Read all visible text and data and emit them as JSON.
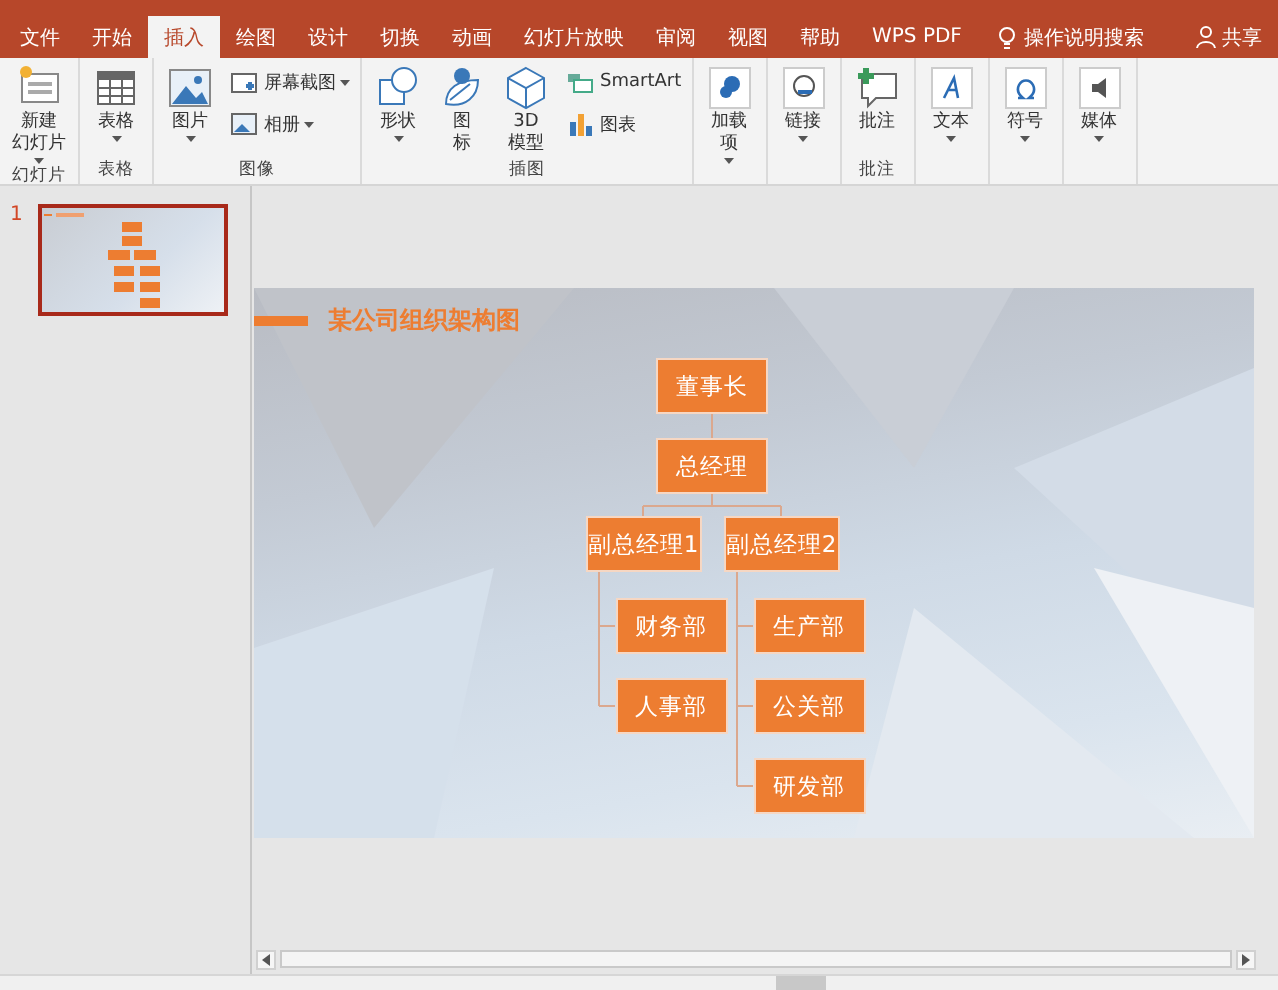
{
  "tabs": [
    {
      "label": "文件",
      "selected": false
    },
    {
      "label": "开始",
      "selected": false
    },
    {
      "label": "插入",
      "selected": true
    },
    {
      "label": "绘图",
      "selected": false
    },
    {
      "label": "设计",
      "selected": false
    },
    {
      "label": "切换",
      "selected": false
    },
    {
      "label": "动画",
      "selected": false
    },
    {
      "label": "幻灯片放映",
      "selected": false
    },
    {
      "label": "审阅",
      "selected": false
    },
    {
      "label": "视图",
      "selected": false
    },
    {
      "label": "帮助",
      "selected": false
    },
    {
      "label": "WPS PDF",
      "selected": false
    }
  ],
  "tell_me": "操作说明搜索",
  "share": "共享",
  "ribbon_groups": [
    {
      "label": "幻灯片",
      "buttons": [
        {
          "kind": "large",
          "label_lines": [
            "新建",
            "幻灯片"
          ],
          "dropdown": true
        }
      ]
    },
    {
      "label": "表格",
      "buttons": [
        {
          "kind": "large",
          "label_lines": [
            "表格"
          ],
          "dropdown": true
        }
      ]
    },
    {
      "label": "图像",
      "buttons": [
        {
          "kind": "large",
          "label_lines": [
            "图片"
          ],
          "dropdown": true
        },
        {
          "kind": "small",
          "label_lines": [
            "屏幕截图"
          ],
          "dropdown": true
        },
        {
          "kind": "small",
          "label_lines": [
            "相册"
          ],
          "dropdown": true
        }
      ]
    },
    {
      "label": "插图",
      "buttons": [
        {
          "kind": "large",
          "label_lines": [
            "形状"
          ],
          "dropdown": true
        },
        {
          "kind": "large",
          "label_lines": [
            "图",
            "标"
          ],
          "dropdown": false
        },
        {
          "kind": "large",
          "label_lines": [
            "3D",
            "模型"
          ],
          "dropdown": false
        },
        {
          "kind": "small",
          "label_lines": [
            "SmartArt"
          ],
          "dropdown": false
        },
        {
          "kind": "small",
          "label_lines": [
            "图表"
          ],
          "dropdown": false
        }
      ]
    },
    {
      "buttons": [
        {
          "kind": "large",
          "label_lines": [
            "加载",
            "项"
          ],
          "dropdown": true
        }
      ]
    },
    {
      "buttons": [
        {
          "kind": "large",
          "label_lines": [
            "链接"
          ],
          "dropdown": true
        }
      ]
    },
    {
      "label": "批注",
      "buttons": [
        {
          "kind": "large",
          "label_lines": [
            "批注"
          ],
          "dropdown": false
        }
      ]
    },
    {
      "buttons": [
        {
          "kind": "large",
          "label_lines": [
            "文本"
          ],
          "dropdown": true
        }
      ]
    },
    {
      "buttons": [
        {
          "kind": "large",
          "label_lines": [
            "符号"
          ],
          "dropdown": true
        }
      ]
    },
    {
      "buttons": [
        {
          "kind": "large",
          "label_lines": [
            "媒体"
          ],
          "dropdown": true
        }
      ]
    }
  ],
  "thumbnails": [
    {
      "number": "1",
      "selected": true
    }
  ],
  "slide": {
    "title": "某公司组织架构图",
    "org_chart": {
      "label": "董事长",
      "children": [
        {
          "label": "总经理",
          "children": [
            {
              "label": "副总经理1",
              "children": [
                {
                  "label": "财务部"
                },
                {
                  "label": "人事部"
                }
              ]
            },
            {
              "label": "副总经理2",
              "children": [
                {
                  "label": "生产部"
                },
                {
                  "label": "公关部"
                },
                {
                  "label": "研发部"
                }
              ]
            }
          ]
        }
      ]
    }
  }
}
